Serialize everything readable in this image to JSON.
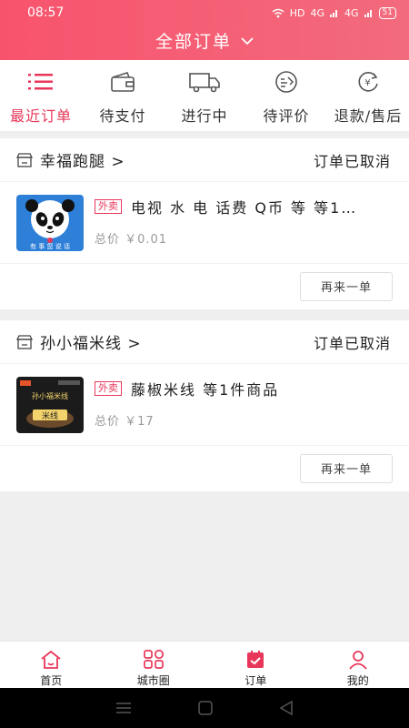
{
  "status_bar": {
    "time": "08:57",
    "network": "HD",
    "signal1": "4G",
    "signal2": "4G",
    "battery": "51"
  },
  "header": {
    "title": "全部订单"
  },
  "tabs": [
    {
      "label": "最近订单",
      "icon": "list-icon",
      "active": true
    },
    {
      "label": "待支付",
      "icon": "wallet-icon"
    },
    {
      "label": "进行中",
      "icon": "truck-icon"
    },
    {
      "label": "待评价",
      "icon": "review-icon"
    },
    {
      "label": "退款/售后",
      "icon": "refund-icon"
    }
  ],
  "orders": [
    {
      "store": "幸福跑腿 >",
      "status": "订单已取消",
      "tag": "外卖",
      "goods": "电视 水 电 话费 Q币 等 等1…",
      "price": "总价 ￥0.01",
      "thumb_text": "有 事 您 说 话",
      "button": "再来一单"
    },
    {
      "store": "孙小福米线 >",
      "status": "订单已取消",
      "tag": "外卖",
      "goods": "藤椒米线 等1件商品",
      "price": "总价 ￥17",
      "thumb_text": "孙小福米线",
      "thumb_sub": "米线",
      "button": "再来一单"
    }
  ],
  "bottom_nav": [
    {
      "label": "首页",
      "icon": "home-icon"
    },
    {
      "label": "城市圈",
      "icon": "city-circle-icon"
    },
    {
      "label": "订单",
      "icon": "order-icon",
      "active": true
    },
    {
      "label": "我的",
      "icon": "user-icon"
    }
  ],
  "colors": {
    "accent": "#e8375a",
    "header_start": "#f8536d",
    "header_end": "#f26b7d",
    "background": "#efefef"
  }
}
